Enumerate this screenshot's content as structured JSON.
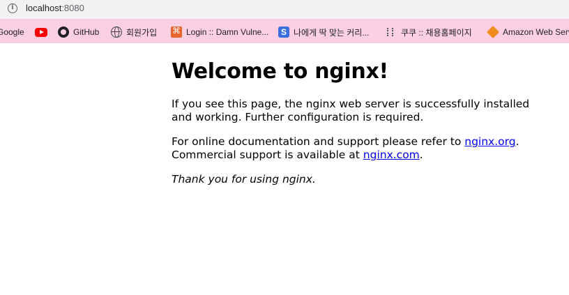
{
  "browser": {
    "url_host": "localhost",
    "url_port": ":8080",
    "bookmarks": [
      {
        "label": "Google",
        "icon": "google-icon"
      },
      {
        "label": "",
        "icon": "youtube-icon"
      },
      {
        "label": "GitHub",
        "icon": "github-icon"
      },
      {
        "label": "회원가입",
        "icon": "globe-icon"
      },
      {
        "label": "Login :: Damn Vulne...",
        "icon": "dvwa-icon"
      },
      {
        "label": "나에게 딱 맞는 커리...",
        "icon": "s-logo-icon"
      },
      {
        "label": "쿠쿠 :: 채용홈페이지",
        "icon": "cucu-icon"
      },
      {
        "label": "Amazon Web Serv",
        "icon": "aws-icon"
      }
    ]
  },
  "page": {
    "heading": "Welcome to nginx!",
    "para1": "If you see this page, the nginx web server is successfully installed and working. Further configuration is required.",
    "para2_prefix": "For online documentation and support please refer to ",
    "link_org": "nginx.org",
    "para2_mid": ".",
    "para2_line2_prefix": "Commercial support is available at ",
    "link_com": "nginx.com",
    "para2_suffix": ".",
    "thanks": "Thank you for using nginx."
  }
}
